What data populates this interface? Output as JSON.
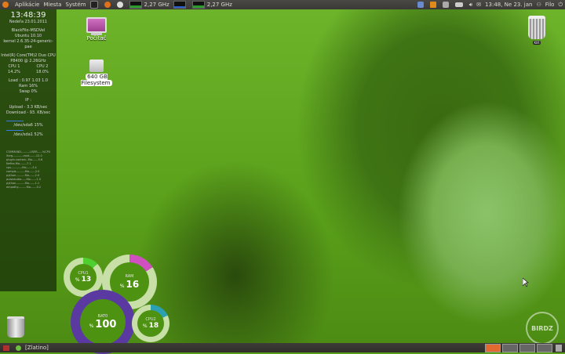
{
  "top_panel": {
    "menus": [
      "Aplikácie",
      "Miesta",
      "Systém"
    ],
    "cpu_freq_1": "2,27 GHz",
    "cpu_freq_2": "2,27 GHz",
    "clock": "13:48, Ne 23. jan",
    "user": "Filo"
  },
  "bottom_panel": {
    "window_title": "[Zlatino]"
  },
  "conky": {
    "time": "13:48:39",
    "date": "Nedeľa 23.01.2011",
    "host": "BlackFilo-MSDVel",
    "distro": "Ubuntu 10.10",
    "kernel": "kernel 2.6.35-24-generic-pae",
    "cpu_model": "Intel(R) Core(TM)2 Duo CPU",
    "cpu_model2": "P8400 @ 2.26GHz",
    "cpu1_label": "CPU 1",
    "cpu2_label": "CPU 2",
    "cpu1_val": "14.2%",
    "cpu2_val": "18.0%",
    "load": "Load : 0.97 1.03 1.0",
    "ram": "Ram 16%",
    "swap": "Swap 0%",
    "ip": "IP :",
    "upload": "Upload - 3.3 KB/sec",
    "download": "Download - 93. KB/sec",
    "disk1": "/dev/sda6 15%",
    "disk2": "/dev/sda1 52%",
    "proc_header": "COMMAND---------USER-----%CPU",
    "procs": [
      "Xorg-----------root-------12.0",
      "plugin-contain--filo------5.6",
      "Nefira-filo-------7.1",
      "cpu-----------filo------3.4",
      "compiz---------filo------2.0",
      "python---------filo------2.0",
      "pulseaudio-----filo------1.0",
      "python---------filo------1.1",
      "empathy--------filo------0.2"
    ]
  },
  "desktop_icons": {
    "computer": "Počítač",
    "filesystem": "640 GB Filesystem",
    "trash_label": "Kôš"
  },
  "rings": {
    "cpu1": {
      "label": "CPU1",
      "value": "13",
      "level": 0.13
    },
    "ram": {
      "label": "RAM",
      "value": "16",
      "level": 0.16
    },
    "bat": {
      "label": "BAT0",
      "value": "100",
      "level": 1.0
    },
    "cpu2": {
      "label": "CPU2",
      "value": "18",
      "level": 0.18
    }
  },
  "watermark": "BIRDZ",
  "colors": {
    "accent_green": "#5aa01a",
    "ring_pink": "#d050c0",
    "ring_teal": "#2aa0b0",
    "ring_purple": "#5a3aa0"
  }
}
